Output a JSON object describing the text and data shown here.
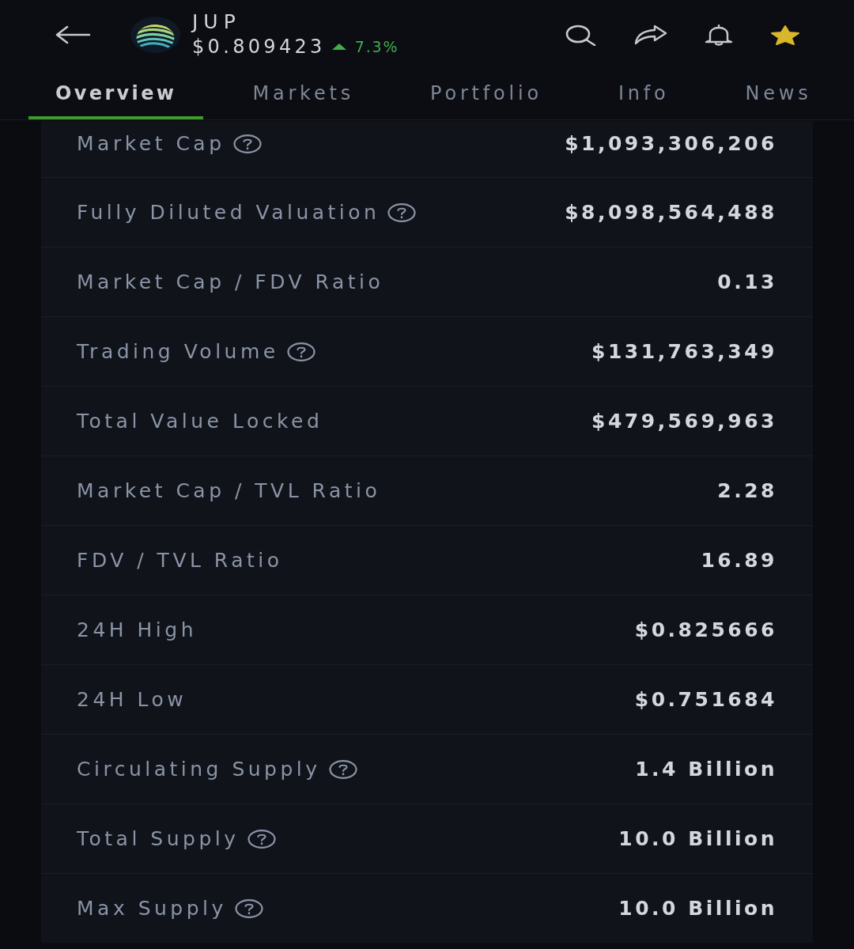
{
  "header": {
    "symbol": "JUP",
    "price": "$0.809423",
    "change": {
      "rising": true,
      "text": "7.3%"
    },
    "favorite": true
  },
  "tabs": [
    {
      "label": "Overview",
      "selected": true
    },
    {
      "label": "Markets",
      "selected": false
    },
    {
      "label": "Portfolio",
      "selected": false
    },
    {
      "label": "Info",
      "selected": false
    },
    {
      "label": "News",
      "selected": false
    }
  ],
  "stats": [
    {
      "label": "Market Cap",
      "info": true,
      "value": "$1,093,306,206"
    },
    {
      "label": "Fully Diluted Valuation",
      "info": true,
      "value": "$8,098,564,488"
    },
    {
      "label": "Market Cap / FDV Ratio",
      "info": false,
      "value": "0.13"
    },
    {
      "label": "Trading Volume",
      "info": true,
      "value": "$131,763,349"
    },
    {
      "label": "Total Value Locked",
      "info": false,
      "value": "$479,569,963"
    },
    {
      "label": "Market Cap / TVL Ratio",
      "info": false,
      "value": "2.28"
    },
    {
      "label": "FDV / TVL Ratio",
      "info": false,
      "value": "16.89"
    },
    {
      "label": "24H High",
      "info": false,
      "value": "$0.825666"
    },
    {
      "label": "24H Low",
      "info": false,
      "value": "$0.751684"
    },
    {
      "label": "Circulating Supply",
      "info": true,
      "value": "1.4 Billion"
    },
    {
      "label": "Total Supply",
      "info": true,
      "value": "10.0 Billion"
    },
    {
      "label": "Max Supply",
      "info": true,
      "value": "10.0 Billion"
    }
  ]
}
